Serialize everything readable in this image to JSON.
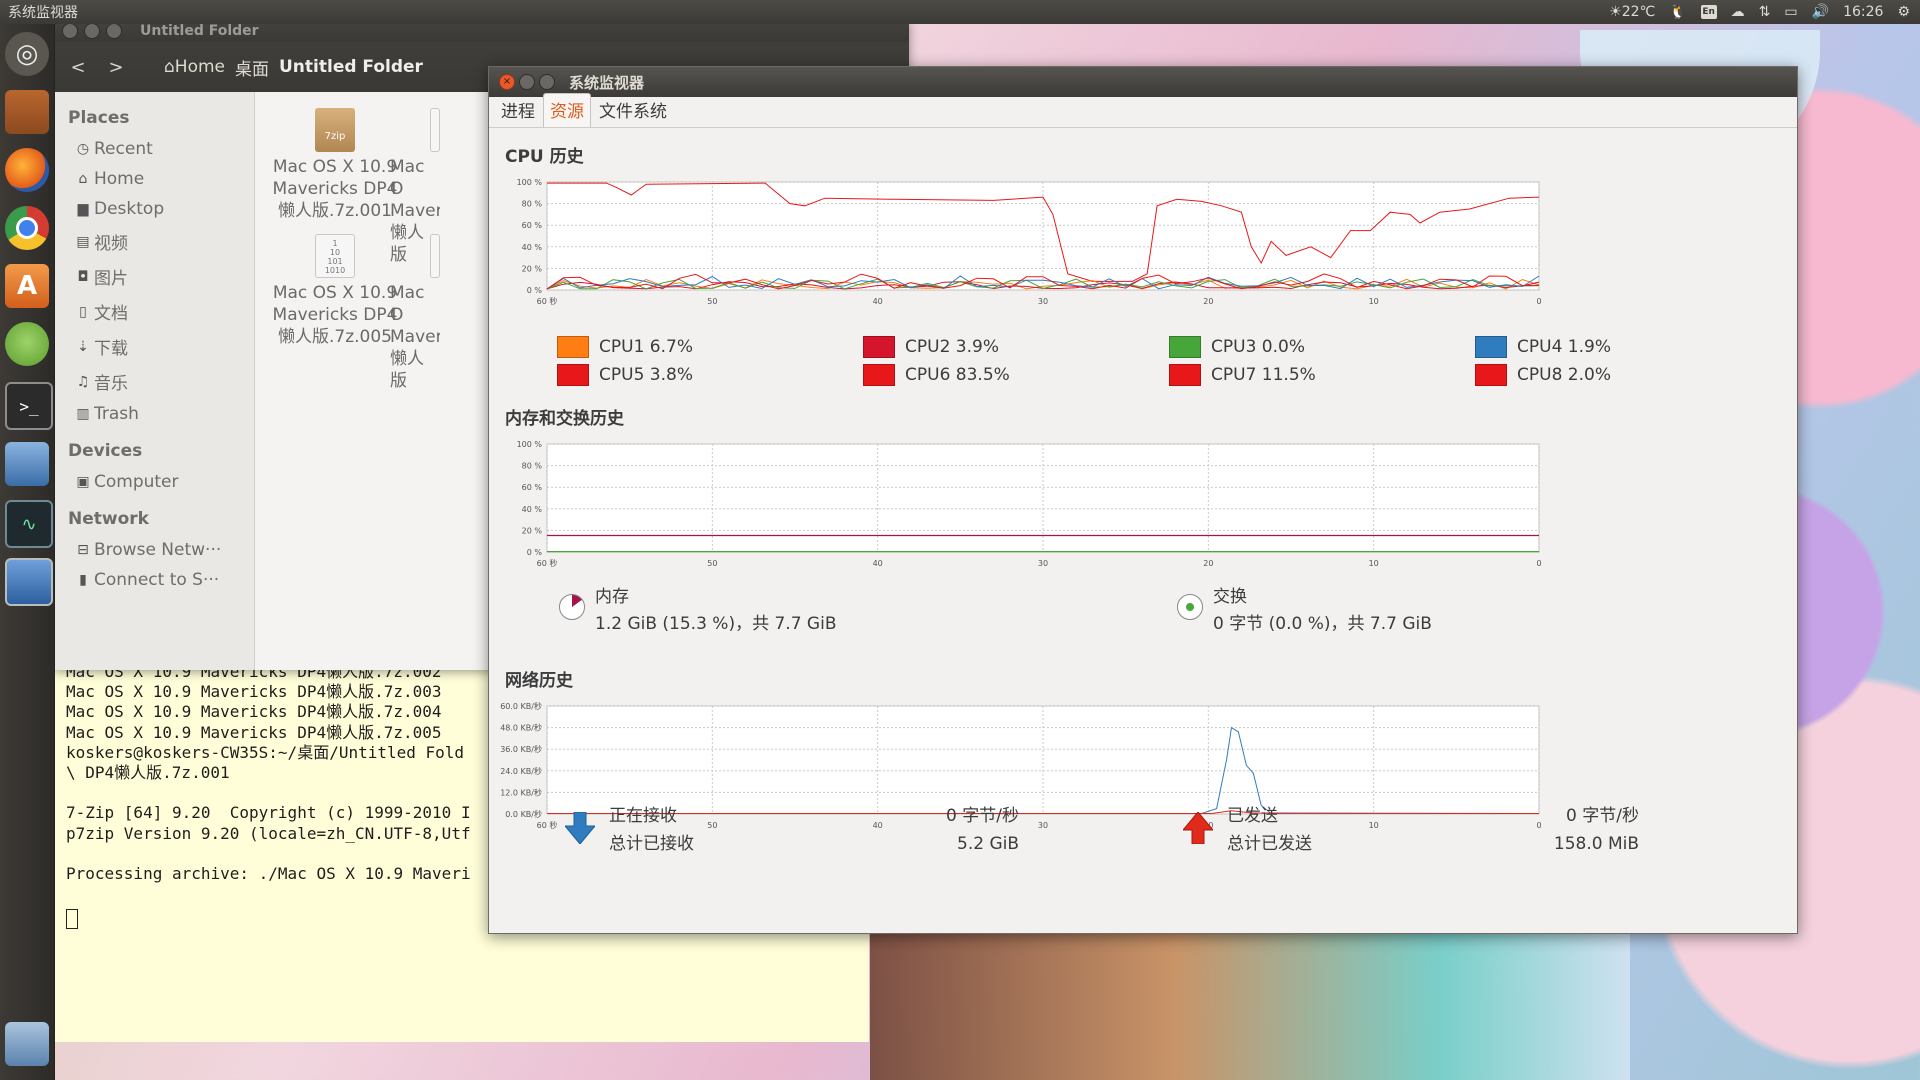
{
  "top_panel": {
    "app_title": "系统监视器",
    "weather": "☀22℃",
    "keyboard": "En",
    "clock": "16:26"
  },
  "launcher": {
    "items": [
      "dash-home",
      "files",
      "firefox",
      "chrome",
      "software-center",
      "pidgin",
      "terminal",
      "system-settings",
      "system-monitor",
      "virtualbox",
      "workspace-switcher"
    ]
  },
  "nautilus": {
    "title": "Untitled Folder",
    "breadcrumbs": [
      "Home",
      "桌面",
      "Untitled Folder"
    ],
    "sidebar": {
      "places_heading": "Places",
      "places": [
        "Recent",
        "Home",
        "Desktop",
        "视频",
        "图片",
        "文档",
        "下载",
        "音乐",
        "Trash"
      ],
      "devices_heading": "Devices",
      "devices": [
        "Computer"
      ],
      "network_heading": "Network",
      "network": [
        "Browse Netw···",
        "Connect to S···"
      ]
    },
    "files": [
      {
        "l1": "Mac OS X 10.9",
        "l2": "Mavericks DP4",
        "l3": "懒人版.7z.001",
        "icon_text": "7zip"
      },
      {
        "l1": "Mac O",
        "l2": "Maveri",
        "l3": "懒人版"
      },
      {
        "l1": "Mac OS X 10.9",
        "l2": "Mavericks DP4",
        "l3": "懒人版.7z.005",
        "icon_text": "1\n10\n101\n1010"
      },
      {
        "l1": "Mac O",
        "l2": "Maveri",
        "l3": "懒人版"
      }
    ]
  },
  "terminal": {
    "lines": [
      "Mac OS X 10.9 Mavericks DP4懒人版.7z.002",
      "Mac OS X 10.9 Mavericks DP4懒人版.7z.003",
      "Mac OS X 10.9 Mavericks DP4懒人版.7z.004",
      "Mac OS X 10.9 Mavericks DP4懒人版.7z.005",
      "koskers@koskers-CW35S:~/桌面/Untitled Fold",
      "\\ DP4懒人版.7z.001",
      "",
      "7-Zip [64] 9.20  Copyright (c) 1999-2010 I",
      "p7zip Version 9.20 (locale=zh_CN.UTF-8,Utf",
      "",
      "Processing archive: ./Mac OS X 10.9 Maveri",
      ""
    ]
  },
  "sysmon": {
    "title": "系统监视器",
    "tabs": [
      "进程",
      "资源",
      "文件系统"
    ],
    "active_tab": "资源",
    "cpu": {
      "title": "CPU 历史",
      "y_ticks": [
        "100 %",
        "80 %",
        "60 %",
        "40 %",
        "20 %",
        "0 %"
      ],
      "x_ticks": [
        "60 秒",
        "50",
        "40",
        "30",
        "20",
        "10",
        "0"
      ],
      "legend": [
        {
          "label": "CPU1 6.7%",
          "color": "#ff7e14"
        },
        {
          "label": "CPU2 3.9%",
          "color": "#d5152c"
        },
        {
          "label": "CPU3 0.0%",
          "color": "#46a63a"
        },
        {
          "label": "CPU4 1.9%",
          "color": "#2f7dbf"
        },
        {
          "label": "CPU5 3.8%",
          "color": "#e8181a"
        },
        {
          "label": "CPU6 83.5%",
          "color": "#e8181a"
        },
        {
          "label": "CPU7 11.5%",
          "color": "#e8181a"
        },
        {
          "label": "CPU8 2.0%",
          "color": "#e8181a"
        }
      ]
    },
    "memory": {
      "title": "内存和交换历史",
      "y_ticks": [
        "100 %",
        "80 %",
        "60 %",
        "40 %",
        "20 %",
        "0 %"
      ],
      "x_ticks": [
        "60 秒",
        "50",
        "40",
        "30",
        "20",
        "10",
        "0"
      ],
      "mem_label": "内存",
      "mem_value": "1.2 GiB (15.3 %)，共 7.7 GiB",
      "mem_color": "#a4134a",
      "swap_label": "交换",
      "swap_value": "0 字节 (0.0 %)，共 7.7 GiB",
      "swap_color": "#4ba63a"
    },
    "network": {
      "title": "网络历史",
      "y_ticks": [
        "60.0 KB/秒",
        "48.0 KB/秒",
        "36.0 KB/秒",
        "24.0 KB/秒",
        "12.0 KB/秒",
        "0.0 KB/秒"
      ],
      "x_ticks": [
        "60 秒",
        "50",
        "40",
        "30",
        "20",
        "10",
        "0"
      ],
      "recv_label": "正在接收",
      "recv_total_label": "总计已接收",
      "recv_rate": "0 字节/秒",
      "recv_total": "5.2 GiB",
      "recv_color": "#2f7dbf",
      "send_label": "已发送",
      "send_total_label": "总计已发送",
      "send_rate": "0 字节/秒",
      "send_total": "158.0 MiB",
      "send_color": "#e02a1a"
    }
  }
}
